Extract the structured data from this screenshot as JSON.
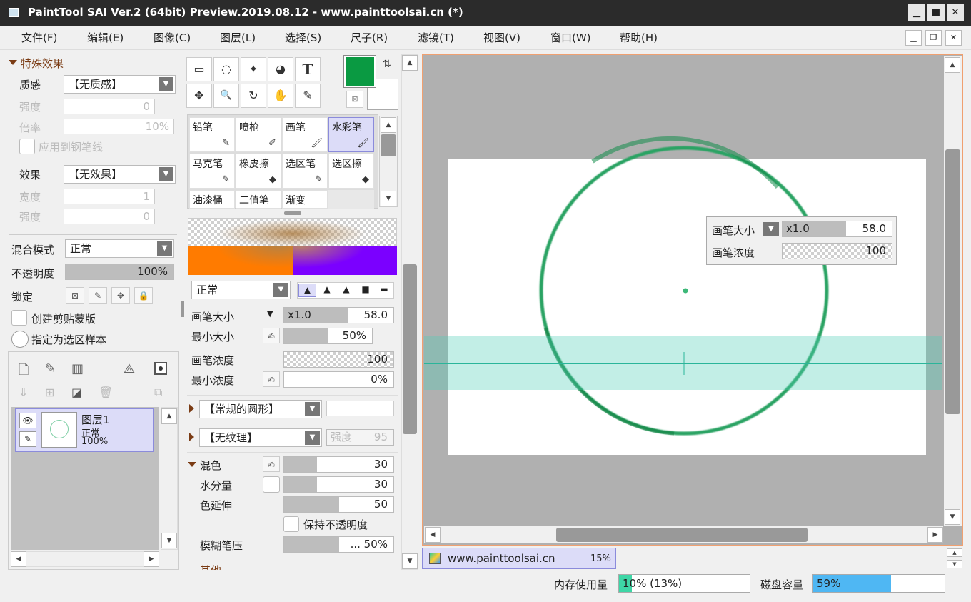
{
  "window": {
    "title": "PaintTool SAI Ver.2 (64bit) Preview.2019.08.12 - www.painttoolsai.cn (*)",
    "min": "▁",
    "max": "■",
    "close": "✕"
  },
  "menu": [
    "文件(F)",
    "编辑(E)",
    "图像(C)",
    "图层(L)",
    "选择(S)",
    "尺子(R)",
    "滤镜(T)",
    "视图(V)",
    "窗口(W)",
    "帮助(H)"
  ],
  "fx": {
    "header": "特殊效果",
    "texture_label": "质感",
    "texture_value": "【无质感】",
    "strength_label": "强度",
    "strength_value": "0",
    "scale_label": "倍率",
    "scale_value": "10%",
    "apply_pen": "应用到钢笔线",
    "effect_label": "效果",
    "effect_value": "【无效果】",
    "width_label": "宽度",
    "width_value": "1",
    "strength2_label": "强度",
    "strength2_value": "0"
  },
  "layer_props": {
    "blend_label": "混合模式",
    "blend_value": "正常",
    "opacity_label": "不透明度",
    "opacity_value": "100%",
    "opacity_frac": 1.0,
    "lock_label": "锁定",
    "clip_label": "创建剪贴蒙版",
    "sample_label": "指定为选区样本"
  },
  "layers": [
    {
      "name": "图层1",
      "mode": "正常",
      "opacity": "100%"
    }
  ],
  "tools": [
    "▭",
    "◌",
    "✦",
    "◕",
    "T",
    "✥",
    "🔍",
    "↻",
    "✋",
    "✎"
  ],
  "brushes": [
    {
      "name": "铅笔",
      "icon": "✎"
    },
    {
      "name": "喷枪",
      "icon": "✐"
    },
    {
      "name": "画笔",
      "icon": "🖌"
    },
    {
      "name": "水彩笔",
      "icon": "🖌",
      "selected": true
    },
    {
      "name": "马克笔",
      "icon": "✎"
    },
    {
      "name": "橡皮擦",
      "icon": "◆"
    },
    {
      "name": "选区笔",
      "icon": "✎"
    },
    {
      "name": "选区擦",
      "icon": "◆"
    },
    {
      "name": "油漆桶",
      "icon": ""
    },
    {
      "name": "二值笔",
      "icon": ""
    },
    {
      "name": "渐变",
      "icon": ""
    }
  ],
  "colors": {
    "primary": "#0a9a42",
    "secondary": "#ffffff",
    "accent": "#4fb7f3"
  },
  "brush_settings": {
    "mode": "正常",
    "size_label": "画笔大小",
    "size_mult": "x1.0",
    "size_value": "58.0",
    "size_frac": 0.58,
    "min_size_label": "最小大小",
    "min_size_value": "50%",
    "min_size_frac": 0.5,
    "density_label": "画笔浓度",
    "density_value": "100",
    "min_density_label": "最小浓度",
    "min_density_value": "0%",
    "shape": "【常规的圆形】",
    "texture": "【无纹理】",
    "texture_strength_label": "强度",
    "texture_strength_value": "95",
    "blend_label": "混色",
    "blend_value": "30",
    "blend_frac": 0.3,
    "water_label": "水分量",
    "water_value": "30",
    "water_frac": 0.3,
    "stretch_label": "色延伸",
    "stretch_value": "50",
    "stretch_frac": 0.5,
    "keep_opacity_label": "保持不透明度",
    "blur_label": "模糊笔压",
    "blur_value": "... 50%",
    "blur_frac": 0.5,
    "more_label": "其他"
  },
  "popup": {
    "size_label": "画笔大小",
    "size_mult": "x1.0",
    "size_value": "58.0",
    "density_label": "画笔浓度",
    "density_value": "100"
  },
  "doc_tab": {
    "name": "www.painttoolsai.cn",
    "zoom": "15%"
  },
  "status": {
    "mem_label": "内存使用量",
    "mem_value": "10% (13%)",
    "mem_frac": 0.1,
    "disk_label": "磁盘容量",
    "disk_value": "59%",
    "disk_frac": 0.59
  }
}
